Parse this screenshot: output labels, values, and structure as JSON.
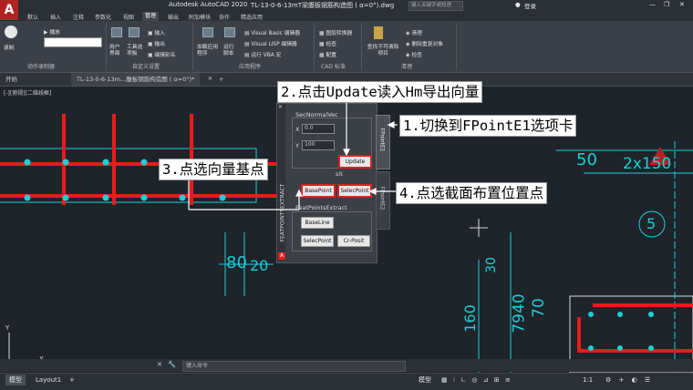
{
  "app": {
    "logo_letter": "A",
    "title": "Autodesk AutoCAD 2020",
    "filename": "TL-13-0-6-13mT梁腹板钢筋构造图 ( α=0°).dwg",
    "search_placeholder": "键入关键字或短语",
    "user": "登录",
    "window_controls": [
      "—",
      "❐",
      "✕"
    ]
  },
  "ribbon": {
    "tabs": [
      "默认",
      "插入",
      "注释",
      "参数化",
      "视图",
      "管理",
      "输出",
      "附加模块",
      "协作",
      "精选应用"
    ],
    "active_tab": "管理",
    "record_label": "录制",
    "play_label": "播放",
    "panels": [
      "动作录制器",
      "自定义设置",
      "应用程序",
      "CAD 标准",
      "清理"
    ],
    "custom_buttons": [
      "用户界面",
      "工具选项板",
      "输入",
      "输出",
      "编辑别名"
    ],
    "app_buttons": [
      "加载应用程序",
      "运行脚本",
      "Visual Basic 编辑器",
      "Visual LISP 编辑器",
      "运行 VBA 宏"
    ],
    "cad_std_buttons": [
      "图层转换器",
      "检查",
      "配置"
    ],
    "clean_buttons": [
      "查找不可清除项目",
      "清理",
      "删除重复对象",
      "检查"
    ]
  },
  "doc_tabs": [
    "开始",
    "TL-13-0-6-13m...腹板钢筋构造图 ( α=0°)*"
  ],
  "viewport_label": "[-][俯视][二维线框]",
  "palette": {
    "vertical_title": "FEATPOINTSEXTRACT",
    "side_tab1": "FPointE1",
    "side_tab2": "FPointE2",
    "section1_title": "SecNormalVec",
    "x_label": "X",
    "x_value": "0.0",
    "y_label": "Y",
    "y_value": "100",
    "update_button": "Update",
    "partial_label": "sit",
    "basepoint_button": "BasePoint",
    "selectpoint_button": "SelecPoint",
    "section2_title": "FeatPointsExtract",
    "baseline_button": "BaseLine",
    "selecpoint2_button": "SelecPoint",
    "crposit_button": "Cr-Posit"
  },
  "callouts": {
    "c1": "1.切换到FPointE1选项卡",
    "c2": "2.点击Update读入Hm导出向量",
    "c3": "3.点选向量基点",
    "c4": "4.点选截面布置位置点"
  },
  "drawing": {
    "dim_50": "50",
    "dim_2x150": "2x150",
    "dim_5": "5",
    "dim_80": "80",
    "dim_20": "20",
    "dim_30": "30",
    "dim_160": "160",
    "dim_7940": "7940",
    "dim_70": "70",
    "axis_y": "Y",
    "axis_x": "X"
  },
  "command_line": {
    "placeholder": "键入命令"
  },
  "status_bar": {
    "tabs": [
      "模型",
      "Layout1"
    ],
    "active_tab": "模型",
    "model_label": "模型",
    "scale": "1:1",
    "add_symbol": "+"
  },
  "colors": {
    "rebar": "#e81c1c",
    "points": "#19d0d8",
    "linework": "#19d0d8",
    "callout_arrow": "#ffffff",
    "highlight": "#e02020"
  }
}
